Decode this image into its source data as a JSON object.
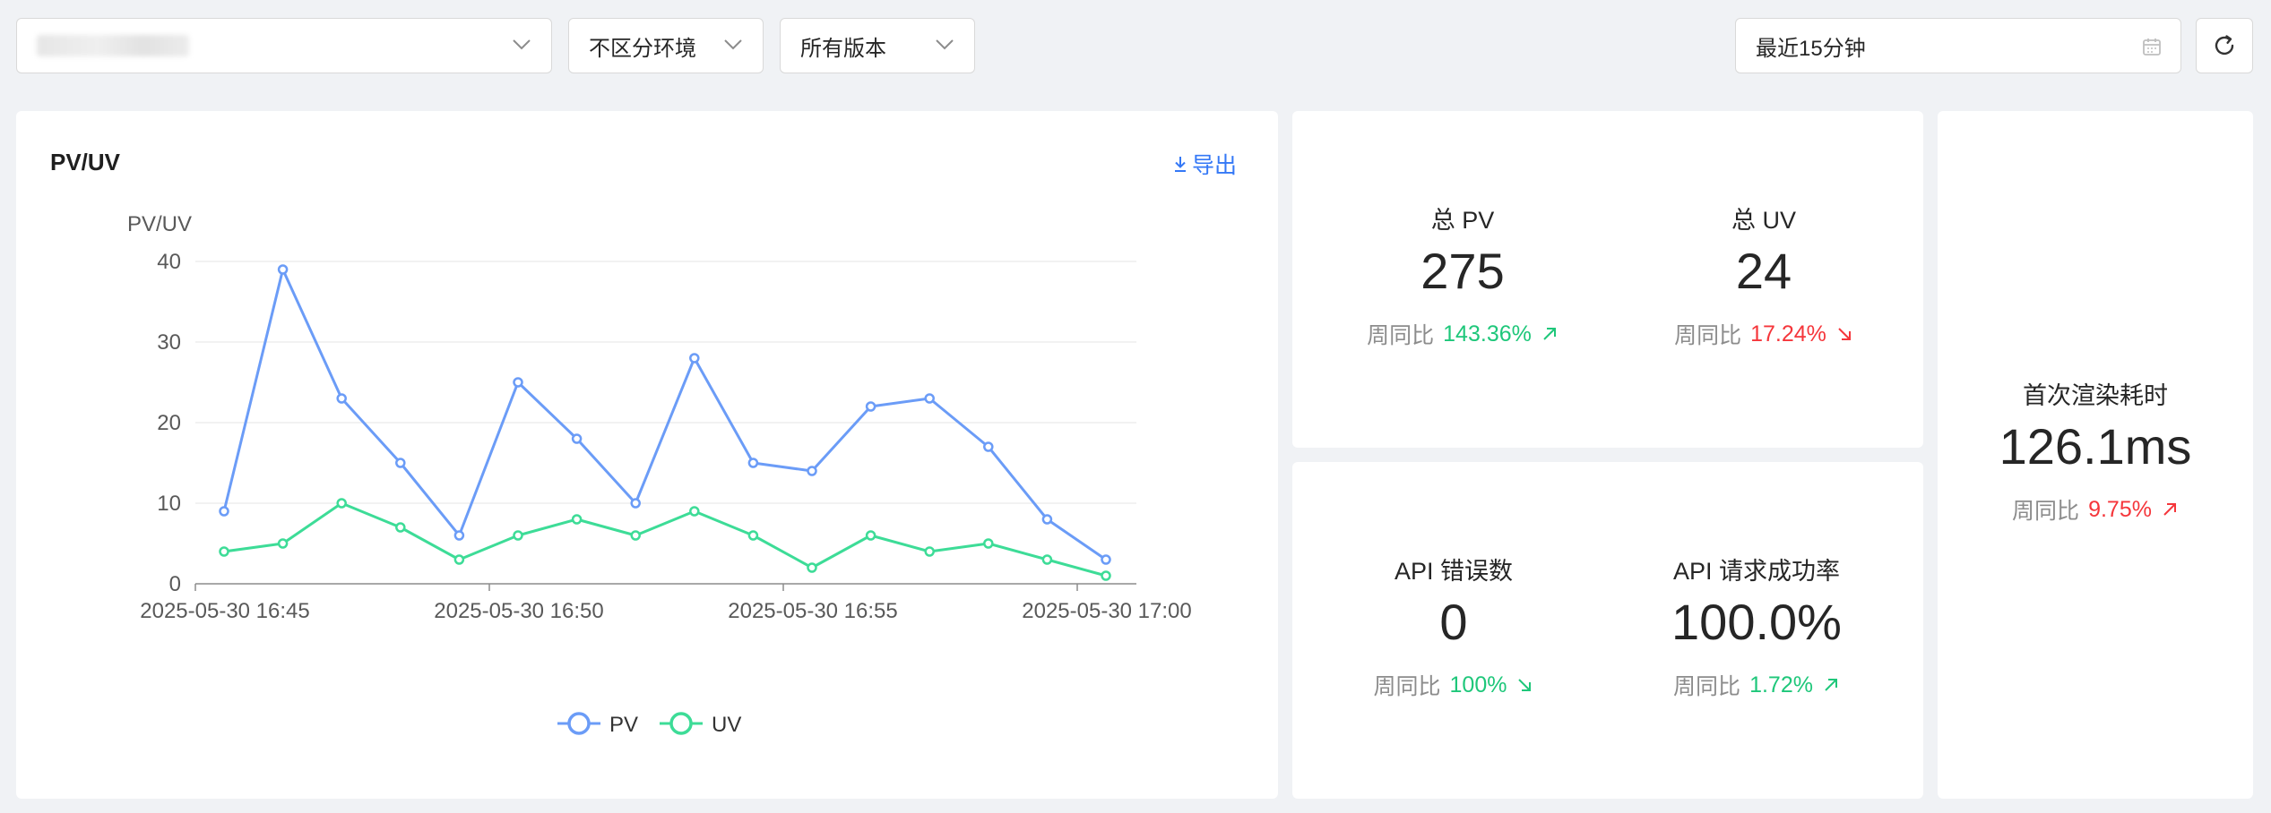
{
  "toolbar": {
    "env_select": "不区分环境",
    "version_select": "所有版本",
    "time_range": "最近15分钟"
  },
  "pvuv": {
    "title": "PV/UV",
    "export_label": "导出"
  },
  "stats": {
    "total_pv": {
      "label": "总 PV",
      "value": "275",
      "cmp_label": "周同比",
      "cmp_value": "143.36%",
      "trend": "up"
    },
    "total_uv": {
      "label": "总 UV",
      "value": "24",
      "cmp_label": "周同比",
      "cmp_value": "17.24%",
      "trend": "down"
    },
    "api_errors": {
      "label": "API 错误数",
      "value": "0",
      "cmp_label": "周同比",
      "cmp_value": "100%",
      "trend": "down"
    },
    "api_success": {
      "label": "API 请求成功率",
      "value": "100.0%",
      "cmp_label": "周同比",
      "cmp_value": "1.72%",
      "trend": "up"
    },
    "first_render": {
      "label": "首次渲染耗时",
      "value": "126.1ms",
      "cmp_label": "周同比",
      "cmp_value": "9.75%",
      "trend": "up"
    }
  },
  "colors": {
    "pv": "#6b9cf7",
    "uv": "#3ddc97",
    "up": "#1ec77a",
    "down": "#f5363b",
    "accent": "#3478f6"
  },
  "chart_data": {
    "type": "line",
    "title": "",
    "ylabel": "PV/UV",
    "xlabel": "",
    "ylim": [
      0,
      40
    ],
    "yticks": [
      0,
      10,
      20,
      30,
      40
    ],
    "xtick_labels": [
      "2025-05-30 16:45",
      "2025-05-30 16:50",
      "2025-05-30 16:55",
      "2025-05-30 17:00"
    ],
    "legend_position": "bottom-center",
    "grid": true,
    "series": [
      {
        "name": "PV",
        "values": [
          9,
          39,
          23,
          15,
          6,
          25,
          18,
          10,
          28,
          15,
          14,
          22,
          23,
          17,
          8,
          3
        ]
      },
      {
        "name": "UV",
        "values": [
          4,
          5,
          10,
          7,
          3,
          6,
          8,
          6,
          9,
          6,
          2,
          6,
          4,
          5,
          3,
          1
        ]
      }
    ]
  }
}
